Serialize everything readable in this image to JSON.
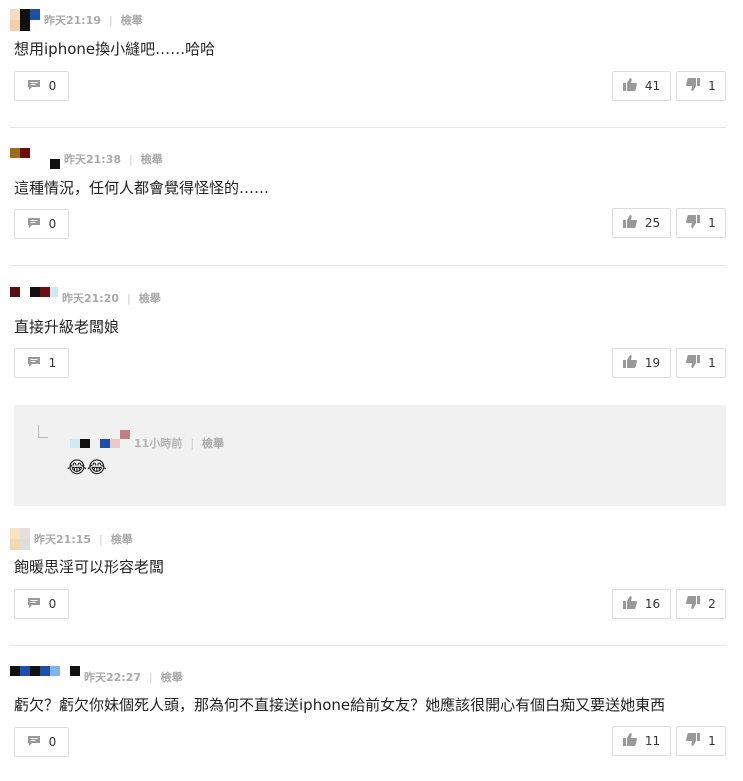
{
  "labels": {
    "report": "檢舉",
    "separator": "|"
  },
  "comments": [
    {
      "time": "昨天21:19",
      "text": "想用iphone換小縫吧……哈哈",
      "replies": "0",
      "likes": "41",
      "dislikes": "1"
    },
    {
      "time": "昨天21:38",
      "text": "這種情況，任何人都會覺得怪怪的……",
      "replies": "0",
      "likes": "25",
      "dislikes": "1"
    },
    {
      "time": "昨天21:20",
      "text": "直接升級老闆娘",
      "replies": "1",
      "likes": "19",
      "dislikes": "1"
    },
    {
      "time": "昨天21:15",
      "text": "飽暖思淫可以形容老闆",
      "replies": "0",
      "likes": "16",
      "dislikes": "2"
    },
    {
      "time": "昨天22:27",
      "text": "虧欠？虧欠你妹個死人頭，那為何不直接送iphone給前女友？她應該很開心有個白痴又要送她東西",
      "replies": "0",
      "likes": "11",
      "dislikes": "1"
    }
  ],
  "reply": {
    "time": "11小時前",
    "text": "😂😂"
  },
  "colors": {
    "border": "#dddddd",
    "meta_text": "#aaaaaa",
    "reply_bg": "#f1f1f1"
  }
}
